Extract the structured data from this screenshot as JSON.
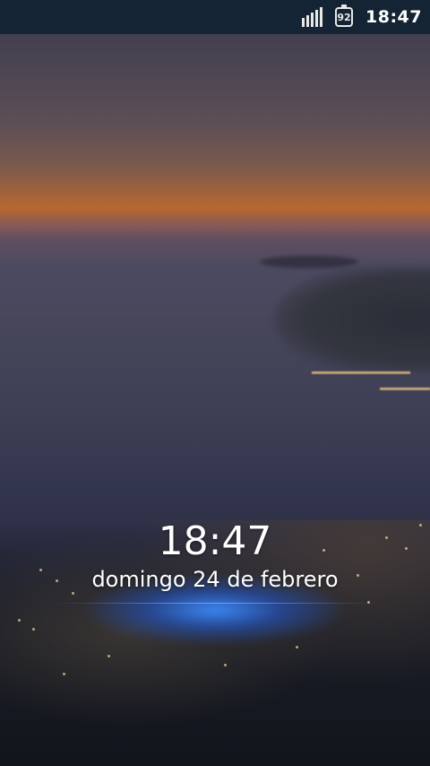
{
  "status_bar": {
    "battery_level": "92",
    "time": "18:47",
    "icons": [
      "signal-icon",
      "battery-icon"
    ]
  },
  "lock_screen": {
    "time": "18:47",
    "date": "domingo 24 de febrero"
  },
  "colors": {
    "status_bar_bg": "#142434",
    "glow": "#3c8cff",
    "text": "#ffffff"
  }
}
